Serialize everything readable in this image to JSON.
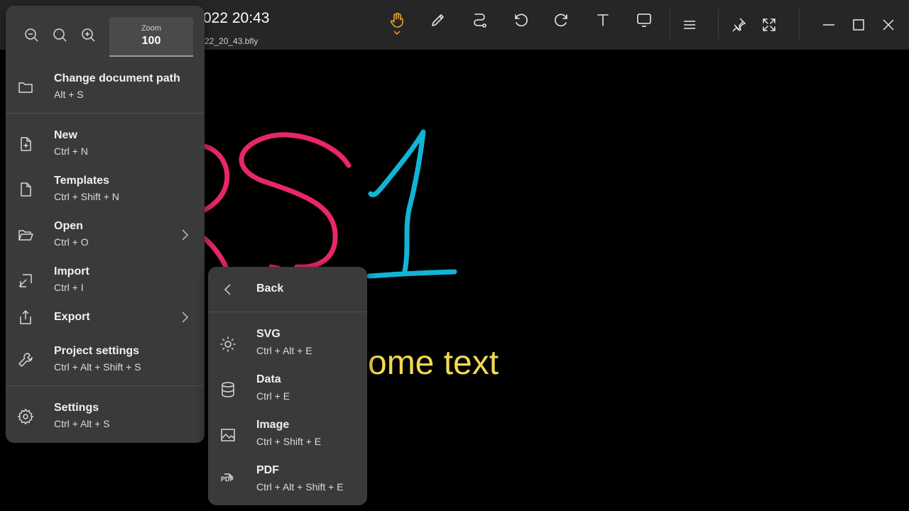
{
  "app": {
    "doc_title": "022 20:43",
    "doc_file": "22_20_43.bfly"
  },
  "toolbar": {
    "tools": [
      "hand-icon",
      "pen-icon",
      "path-icon",
      "undo-icon",
      "redo-icon",
      "text-icon",
      "screen-icon"
    ],
    "active_tool": "hand",
    "accent_color": "#f0a030"
  },
  "window_controls": [
    "menu-icon",
    "pin-icon",
    "fullscreen-icon",
    "minimize-icon",
    "maximize-icon",
    "close-icon"
  ],
  "canvas": {
    "text": "ome text",
    "text_color": "#f2d94e",
    "stroke_colors": [
      "#e8266a",
      "#12b4d6"
    ]
  },
  "main_menu": {
    "zoom": {
      "label": "Zoom",
      "value": "100"
    },
    "items": [
      {
        "label": "Change document path",
        "shortcut": "Alt + S",
        "icon": "folder-icon"
      },
      {
        "label": "New",
        "shortcut": "Ctrl + N",
        "icon": "new-file-icon"
      },
      {
        "label": "Templates",
        "shortcut": "Ctrl + Shift + N",
        "icon": "file-icon"
      },
      {
        "label": "Open",
        "shortcut": "Ctrl + O",
        "icon": "folder-open-icon"
      },
      {
        "label": "Import",
        "shortcut": "Ctrl + I",
        "icon": "import-icon"
      },
      {
        "label": "Export",
        "shortcut": "",
        "icon": "export-icon"
      },
      {
        "label": "Project settings",
        "shortcut": "Ctrl + Alt + Shift + S",
        "icon": "wrench-icon"
      },
      {
        "label": "Settings",
        "shortcut": "Ctrl + Alt + S",
        "icon": "gear-icon"
      }
    ]
  },
  "export_menu": {
    "back_label": "Back",
    "items": [
      {
        "label": "SVG",
        "shortcut": "Ctrl + Alt + E",
        "icon": "sun-icon"
      },
      {
        "label": "Data",
        "shortcut": "Ctrl + E",
        "icon": "database-icon"
      },
      {
        "label": "Image",
        "shortcut": "Ctrl + Shift + E",
        "icon": "image-icon"
      },
      {
        "label": "PDF",
        "shortcut": "Ctrl + Alt + Shift + E",
        "icon": "pdf-icon"
      }
    ],
    "pdf_glyph": "PDF"
  }
}
